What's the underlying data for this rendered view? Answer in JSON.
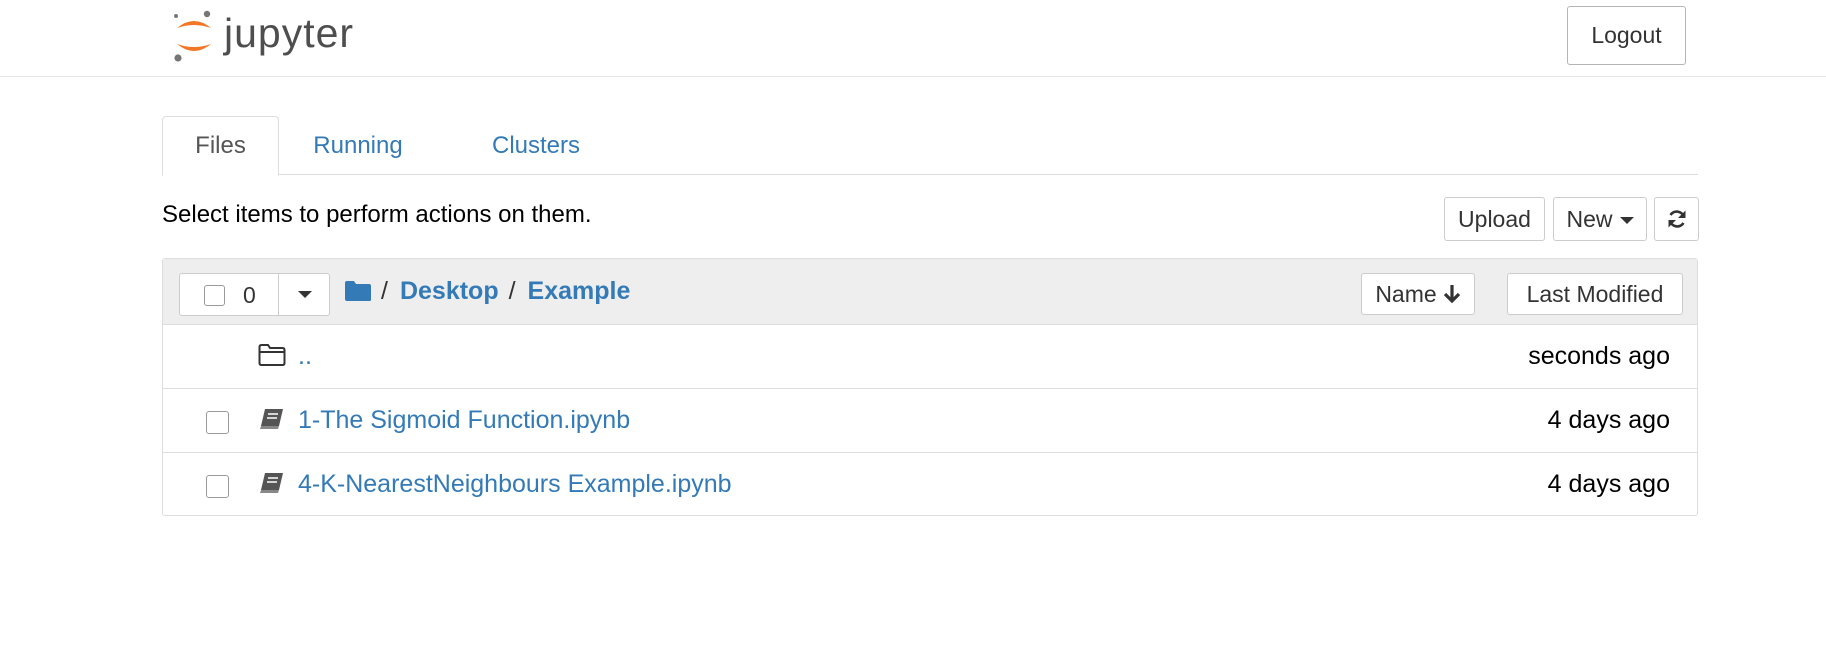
{
  "header": {
    "logo_text": "jupyter",
    "logout_label": "Logout",
    "brand_colors": {
      "orange": "#F37726",
      "grey": "#767677"
    }
  },
  "tabs": [
    {
      "label": "Files",
      "active": true
    },
    {
      "label": "Running",
      "active": false
    },
    {
      "label": "Clusters",
      "active": false
    }
  ],
  "toolbar": {
    "hint": "Select items to perform actions on them.",
    "upload_label": "Upload",
    "new_label": "New",
    "refresh_icon": "refresh-icon"
  },
  "list_header": {
    "selected_count": "0",
    "breadcrumb": [
      {
        "label": "Desktop"
      },
      {
        "label": "Example"
      }
    ],
    "separator": "/",
    "sort_name_label": "Name",
    "sort_modified_label": "Last Modified"
  },
  "items": [
    {
      "name": "..",
      "type": "folder",
      "modified": "seconds ago"
    },
    {
      "name": "1-The Sigmoid Function.ipynb",
      "type": "notebook",
      "modified": "4 days ago"
    },
    {
      "name": "4-K-NearestNeighbours Example.ipynb",
      "type": "notebook",
      "modified": "4 days ago"
    }
  ],
  "colors": {
    "link": "#337ab7",
    "list_header_bg": "#eeeeee",
    "border": "#dddddd"
  }
}
